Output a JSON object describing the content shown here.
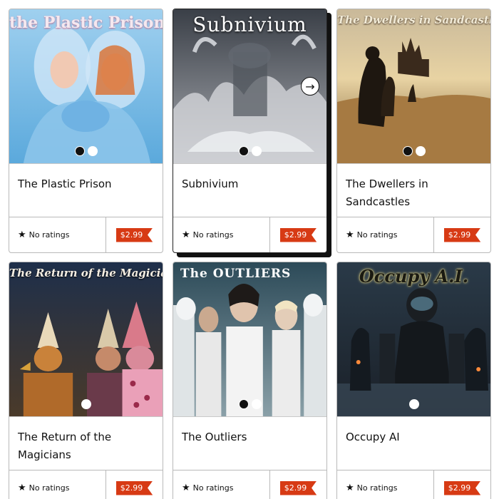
{
  "books": [
    {
      "id": "plastic-prison",
      "cover_title": "the Plastic Prison",
      "title": "The Plastic Prison",
      "rating_text": "No ratings",
      "price": "$2.99"
    },
    {
      "id": "subnivium",
      "cover_title": "Subnivium",
      "title": "Subnivium",
      "rating_text": "No ratings",
      "price": "$2.99"
    },
    {
      "id": "dwellers",
      "cover_title": "The Dwellers in Sandcastles",
      "title": "The Dwellers in Sandcastles",
      "rating_text": "No ratings",
      "price": "$2.99"
    },
    {
      "id": "magicians",
      "cover_title": "The Return of the Magicians",
      "title": "The Return of the Magicians",
      "rating_text": "No ratings",
      "price": "$2.99"
    },
    {
      "id": "outliers",
      "cover_title": "The OUTLIERS",
      "title": "The Outliers",
      "rating_text": "No ratings",
      "price": "$2.99"
    },
    {
      "id": "occupy-ai",
      "cover_title": "Occupy A.I.",
      "title": "Occupy AI",
      "rating_text": "No ratings",
      "price": "$2.99"
    }
  ],
  "icons": {
    "star": "star-icon",
    "next": "arrow-right-icon"
  },
  "colors": {
    "price_tag": "#d73a14",
    "border": "#b9b9b9"
  }
}
